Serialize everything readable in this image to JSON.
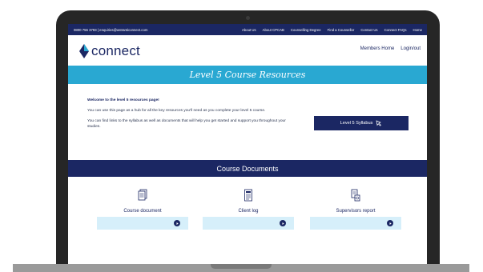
{
  "topbar": {
    "contact": "0800 756 3793 | enquiries@astranticonnect.com",
    "nav": [
      "About Us",
      "About CPCAB",
      "Counselling Degree",
      "Find a Counsellor",
      "Contact Us",
      "Connect FAQs",
      "Home"
    ]
  },
  "logo": {
    "text": "connect"
  },
  "mainnav": {
    "members_home": "Members Home",
    "login": "Login/out"
  },
  "banner": {
    "title": "Level 5 Course Resources"
  },
  "intro": {
    "welcome": "Welcome to the level 5 resources page!",
    "p1": "You can use this page as a hub for all the key resources you'll need as you complete your level 5 course.",
    "p2": "You can find links to the syllabus as well as documents that will help you get started and support you throughout your studies."
  },
  "syllabus": {
    "label": "Level 5 Syllabus"
  },
  "docs": {
    "header": "Course Documents",
    "items": [
      {
        "label": "Course document",
        "icon": "documents-icon"
      },
      {
        "label": "Client log",
        "icon": "log-icon"
      },
      {
        "label": "Supervisors report",
        "icon": "report-icon"
      }
    ]
  },
  "colors": {
    "navy": "#1b2763",
    "accent": "#29a8d2",
    "light": "#d6effa"
  }
}
